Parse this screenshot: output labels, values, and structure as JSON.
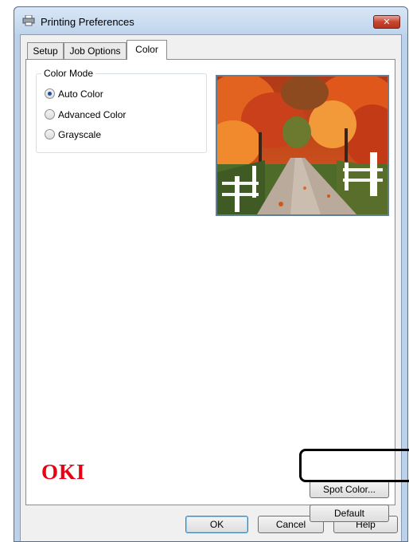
{
  "window": {
    "title": "Printing Preferences",
    "close_glyph": "✕",
    "icons": [
      "printer-icon",
      "close-icon"
    ]
  },
  "tabs": [
    {
      "label": "Setup",
      "active": false
    },
    {
      "label": "Job Options",
      "active": false
    },
    {
      "label": "Color",
      "active": true
    }
  ],
  "color_mode": {
    "legend": "Color Mode",
    "options": [
      {
        "label": "Auto Color",
        "checked": true
      },
      {
        "label": "Advanced Color",
        "checked": false
      },
      {
        "label": "Grayscale",
        "checked": false
      }
    ]
  },
  "preview": {
    "description_icon": "autumn-road-photo"
  },
  "buttons": {
    "spot_color": "Spot Color...",
    "default": "Default",
    "ok": "OK",
    "cancel": "Cancel",
    "help": "Help"
  },
  "brand": {
    "logo_text": "OKI",
    "logo_color": "#e60012"
  },
  "colors": {
    "accent": "#1e4e9c",
    "highlight_border": "#000000"
  }
}
